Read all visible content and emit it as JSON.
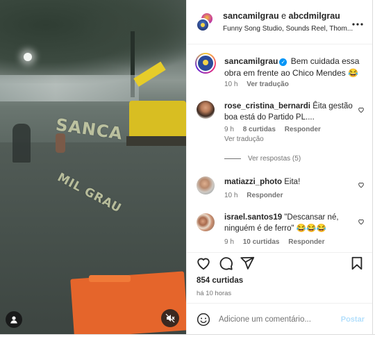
{
  "header": {
    "user1": "sancamilgrau",
    "joiner": " e ",
    "user2": "abcdmilgrau",
    "audio": "Funny Song Studio, Sounds Reel, Thom...",
    "more_icon": "more-horizontal-icon"
  },
  "video": {
    "watermark_line1": "SANCA",
    "watermark_line2": "MIL GRAU",
    "user_icon": "user-icon",
    "mute_icon": "volume-muted-icon"
  },
  "caption": {
    "username": "sancamilgrau",
    "verified_icon": "verified-badge-icon",
    "text": "Bem cuidada essa obra em frente ao Chico Mendes 😂",
    "time": "10 h",
    "see_translation": "Ver tradução"
  },
  "comments": [
    {
      "username": "rose_cristina_bernardi",
      "text": "Êita gestão boa está do Partido PL....",
      "time": "9 h",
      "likes": "8 curtidas",
      "reply": "Responder",
      "see_translation": "Ver tradução",
      "view_replies": "Ver respostas (5)"
    },
    {
      "username": "matiazzi_photo",
      "text": "Eita!",
      "time": "10 h",
      "reply": "Responder"
    },
    {
      "username": "israel.santos19",
      "text": "\"Descansar né, ninguém é de ferro\" 😂😂😂",
      "time": "9 h",
      "likes": "10 curtidas",
      "reply": "Responder"
    }
  ],
  "actions": {
    "like_icon": "heart-icon",
    "comment_icon": "comment-icon",
    "share_icon": "share-icon",
    "save_icon": "bookmark-icon"
  },
  "stats": {
    "likes": "854 curtidas",
    "ago": "há 10 horas"
  },
  "add_comment": {
    "emoji_icon": "emoji-icon",
    "placeholder": "Adicione um comentário...",
    "post_label": "Postar"
  },
  "colors": {
    "accent": "#0095f6",
    "post_disabled": "#b2dffc",
    "secondary_text": "#737373"
  }
}
